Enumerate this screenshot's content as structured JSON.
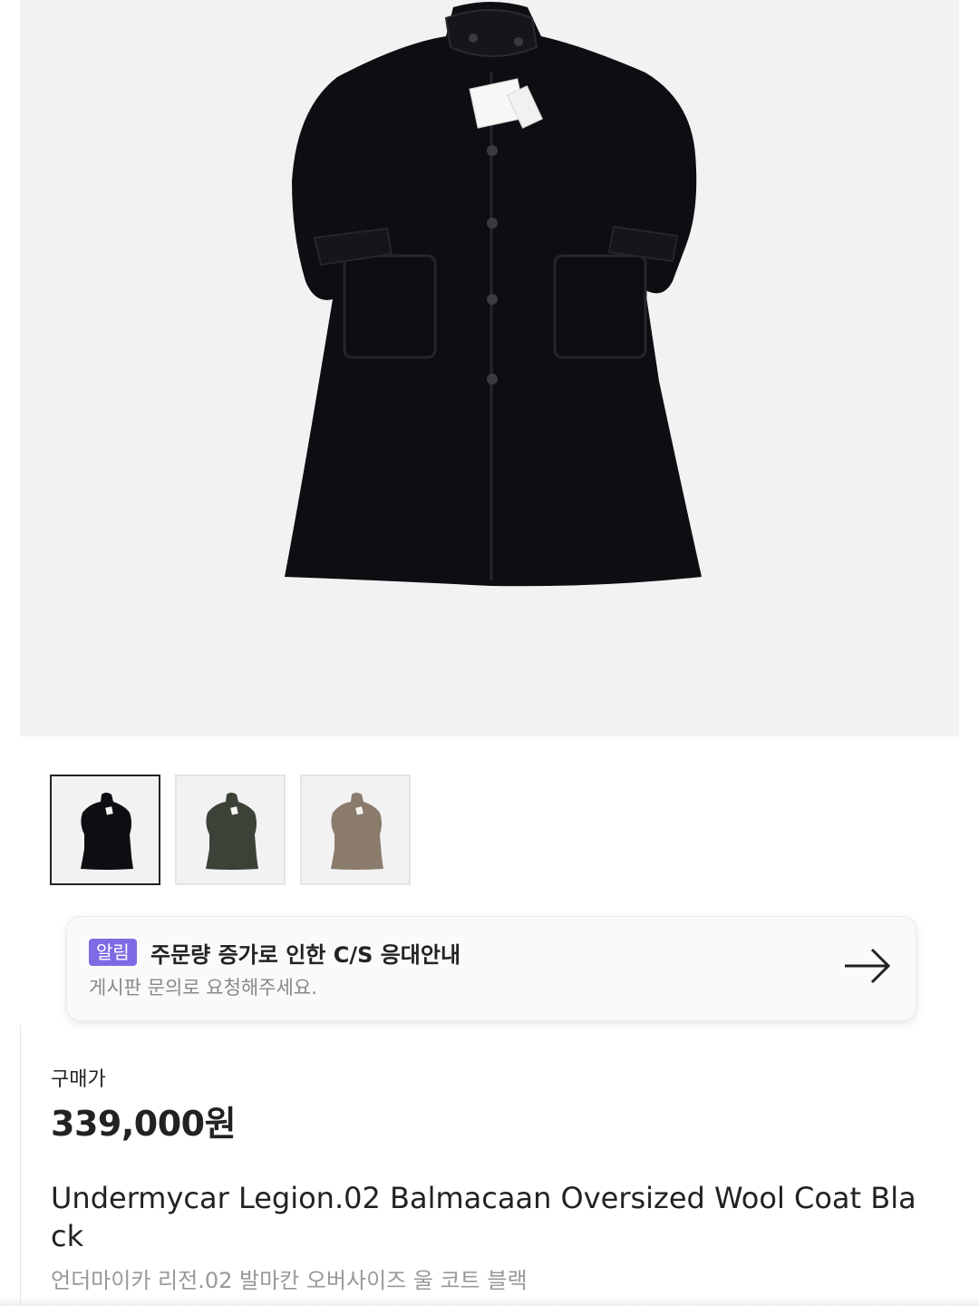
{
  "product": {
    "image_alt": "Undermycar Legion.02 Balmacaan Oversized Wool Coat Black",
    "thumbnails": [
      {
        "color": "#0d0e12",
        "label": "black",
        "selected": true
      },
      {
        "color": "#3c4237",
        "label": "olive",
        "selected": false
      },
      {
        "color": "#8a7b6d",
        "label": "taupe",
        "selected": false
      }
    ],
    "price_label": "구매가",
    "price": "339,000원",
    "name": "Undermycar Legion.02 Balmacaan Oversized Wool Coat Black",
    "name_ko": "언더마이카 리전.02 발마칸 오버사이즈 울 코트 블랙"
  },
  "notice": {
    "badge": "알림",
    "title": "주문량 증가로 인한 C/S 응대안내",
    "subtitle": "게시판 문의로 요청해주세요.",
    "icon": "arrow-right-icon"
  },
  "colors": {
    "badge": "#7d6be6",
    "hero_bg": "#f2f2f3",
    "coat": "#0d0e12"
  }
}
